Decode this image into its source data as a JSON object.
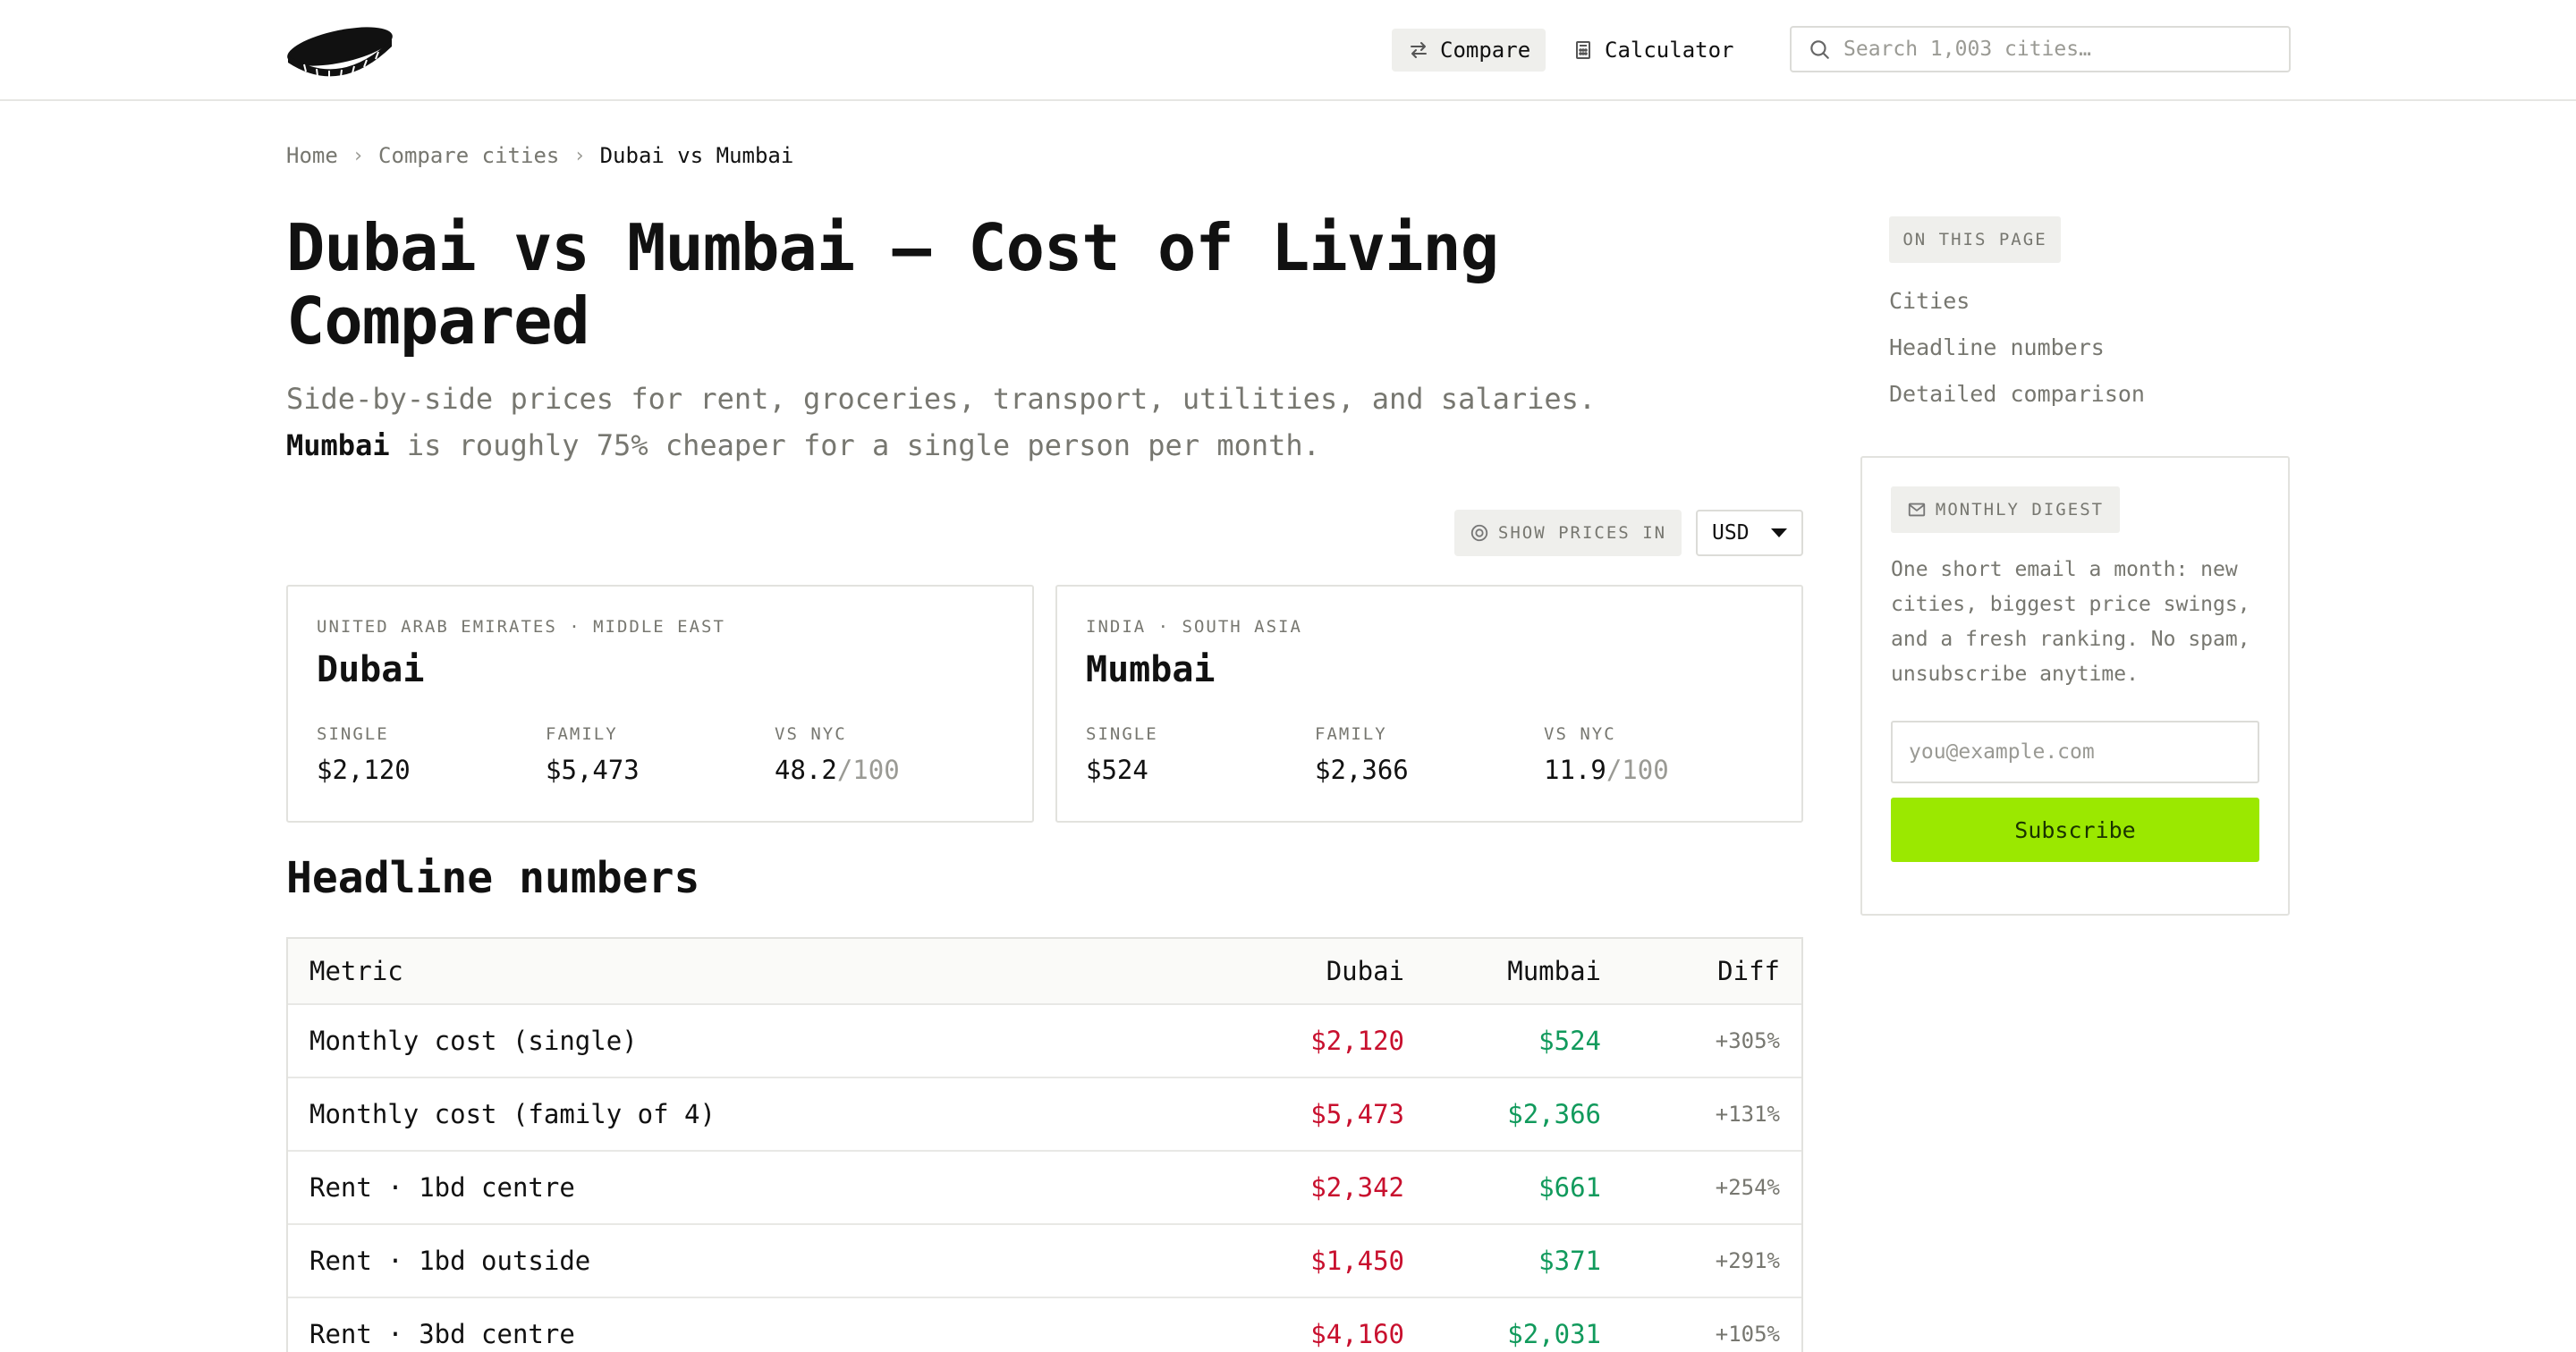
{
  "header": {
    "logo_icon": "coin-logo-icon",
    "nav": [
      {
        "label": "Compare",
        "icon": "swap-arrows-icon"
      },
      {
        "label": "Calculator",
        "icon": "calculator-icon"
      }
    ],
    "search_placeholder": "Search 1,003 cities…"
  },
  "breadcrumb": {
    "home": "Home",
    "compare": "Compare cities",
    "current": "Dubai vs Mumbai"
  },
  "page": {
    "title": "Dubai vs Mumbai — Cost of Living Compared",
    "subtitle_line1": "Side-by-side prices for rent, groceries, transport, utilities, and salaries.",
    "subtitle_city": "Mumbai",
    "subtitle_line2_rest": " is roughly 75% cheaper for a single person per month."
  },
  "currency": {
    "label": "SHOW PRICES IN",
    "selected": "USD"
  },
  "cities": [
    {
      "region": "UNITED ARAB EMIRATES · MIDDLE EAST",
      "name": "Dubai",
      "single_label": "SINGLE",
      "single": "$2,120",
      "family_label": "FAMILY",
      "family": "$5,473",
      "nyc_label": "VS NYC",
      "nyc": "48.2",
      "nyc_suffix": "/100"
    },
    {
      "region": "INDIA · SOUTH ASIA",
      "name": "Mumbai",
      "single_label": "SINGLE",
      "single": "$524",
      "family_label": "FAMILY",
      "family": "$2,366",
      "nyc_label": "VS NYC",
      "nyc": "11.9",
      "nyc_suffix": "/100"
    }
  ],
  "headline": {
    "title": "Headline numbers",
    "columns": [
      "Metric",
      "Dubai",
      "Mumbai",
      "Diff"
    ],
    "rows": [
      {
        "metric": "Monthly cost (single)",
        "dubai": "$2,120",
        "mumbai": "$524",
        "diff": "+305%"
      },
      {
        "metric": "Monthly cost (family of 4)",
        "dubai": "$5,473",
        "mumbai": "$2,366",
        "diff": "+131%"
      },
      {
        "metric": "Rent · 1bd centre",
        "dubai": "$2,342",
        "mumbai": "$661",
        "diff": "+254%"
      },
      {
        "metric": "Rent · 1bd outside",
        "dubai": "$1,450",
        "mumbai": "$371",
        "diff": "+291%"
      },
      {
        "metric": "Rent · 3bd centre",
        "dubai": "$4,160",
        "mumbai": "$2,031",
        "diff": "+105%"
      }
    ]
  },
  "sidebar": {
    "toc_title": "ON THIS PAGE",
    "toc_items": [
      "Cities",
      "Headline numbers",
      "Detailed comparison"
    ],
    "digest_title": "MONTHLY DIGEST",
    "digest_text": "One short email a month: new cities, biggest price swings, and a fresh ranking. No spam, unsubscribe anytime.",
    "email_placeholder": "you@example.com",
    "subscribe_label": "Subscribe"
  },
  "colors": {
    "accent": "#9be800",
    "expensive": "#c8102e",
    "cheaper": "#119a5c"
  }
}
